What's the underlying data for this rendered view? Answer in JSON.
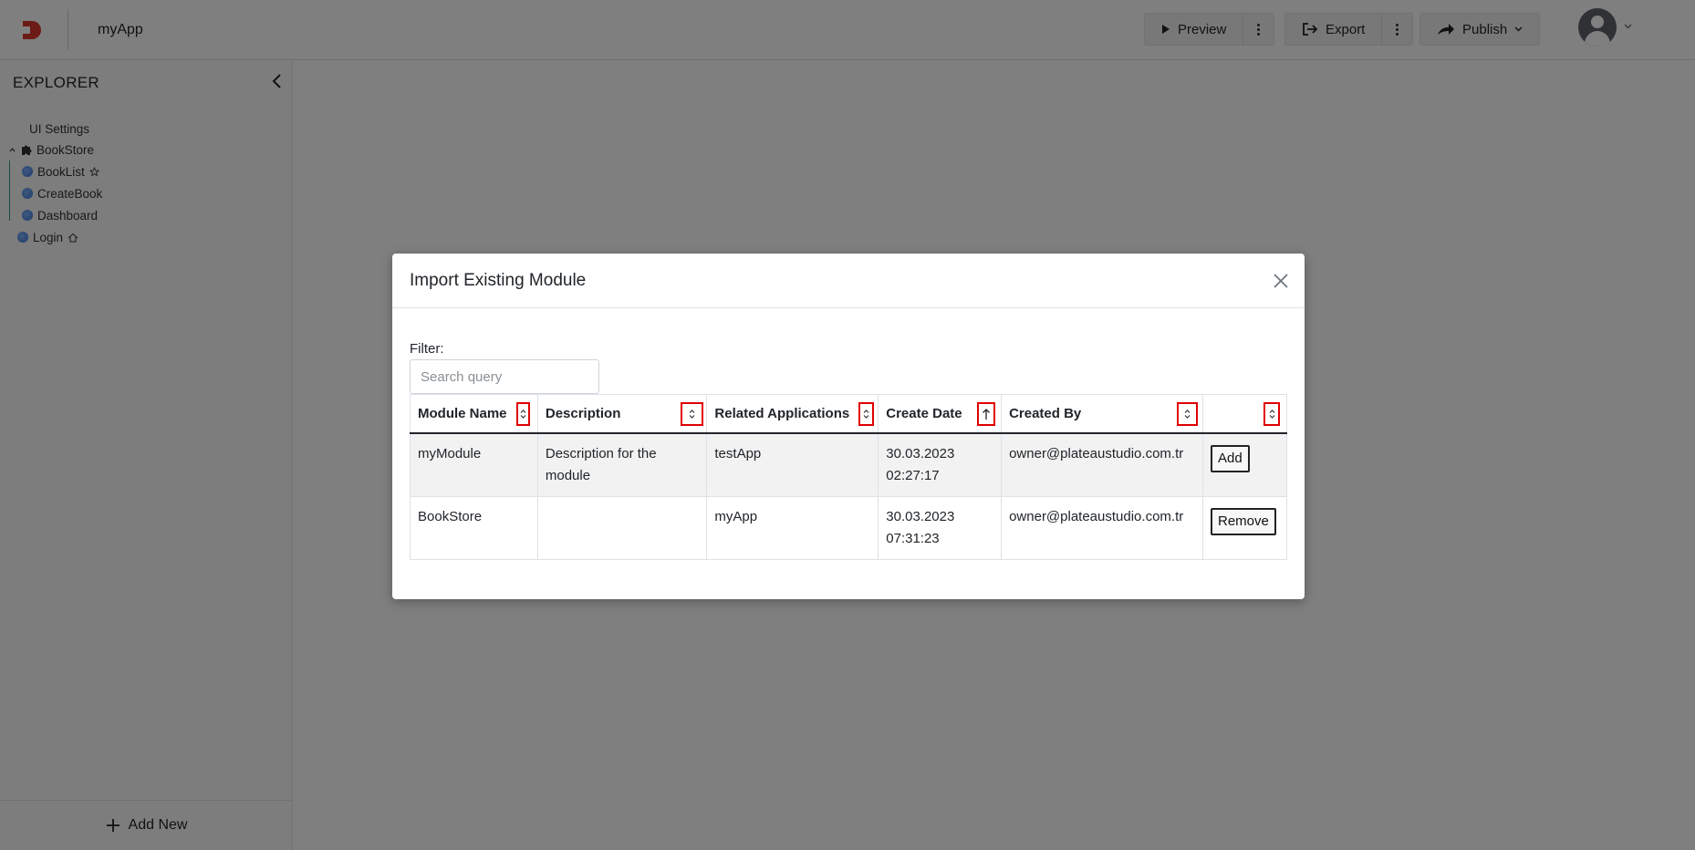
{
  "header": {
    "app_title": "myApp",
    "preview_label": "Preview",
    "export_label": "Export",
    "publish_label": "Publish"
  },
  "sidebar": {
    "title": "EXPLORER",
    "items": [
      {
        "label": "UI Settings"
      },
      {
        "label": "BookStore"
      },
      {
        "label": "BookList"
      },
      {
        "label": "CreateBook"
      },
      {
        "label": "Dashboard"
      },
      {
        "label": "Login"
      }
    ],
    "add_new_label": "Add New"
  },
  "modal": {
    "title": "Import Existing Module",
    "filter_label": "Filter:",
    "search_placeholder": "Search query",
    "columns": [
      "Module Name",
      "Description",
      "Related Applications",
      "Create Date",
      "Created By",
      ""
    ],
    "rows": [
      {
        "module_name": "myModule",
        "description": "Description for the module",
        "related_applications": "testApp",
        "create_date": "30.03.2023 02:27:17",
        "created_by": "owner@plateaustudio.com.tr",
        "action": "Add"
      },
      {
        "module_name": "BookStore",
        "description": "",
        "related_applications": "myApp",
        "create_date": "30.03.2023 07:31:23",
        "created_by": "owner@plateaustudio.com.tr",
        "action": "Remove"
      }
    ]
  },
  "colors": {
    "overlay": "rgba(0,0,0,0.5)",
    "highlight_box": "#e00000",
    "logo": "#d9372b",
    "tree_line": "#2f9a8d"
  }
}
